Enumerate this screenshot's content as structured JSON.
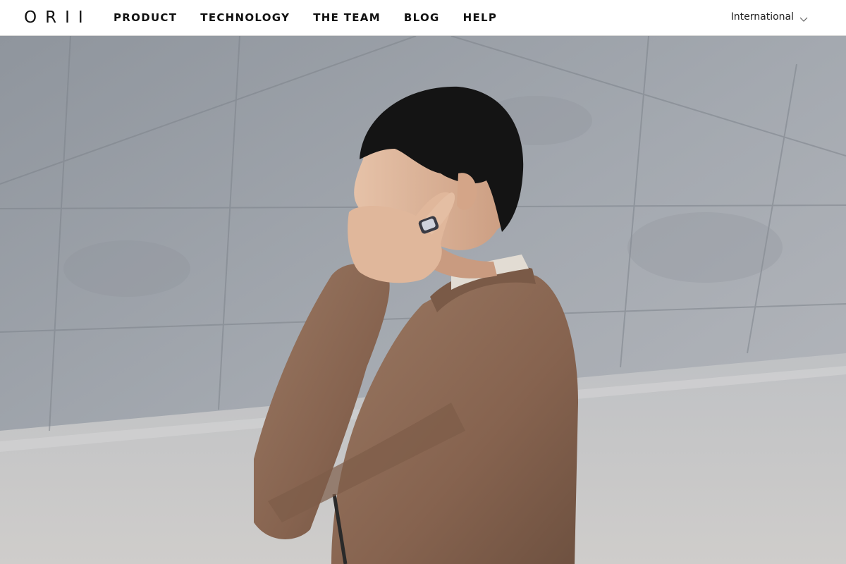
{
  "brand": {
    "logo_text": "ORII"
  },
  "nav": {
    "items": [
      {
        "label": "PRODUCT"
      },
      {
        "label": "TECHNOLOGY"
      },
      {
        "label": "THE TEAM"
      },
      {
        "label": "BLOG"
      },
      {
        "label": "HELP"
      }
    ]
  },
  "locale": {
    "label": "International",
    "icon": "chevron-down-icon"
  },
  "hero": {
    "image_subject": "man in brown suede jacket touching ear with ring-wearing finger in front of concrete wall"
  },
  "colors": {
    "header_bg": "#ffffff",
    "text": "#111111",
    "wall": "#a3a8af",
    "jacket": "#8c6a55"
  }
}
